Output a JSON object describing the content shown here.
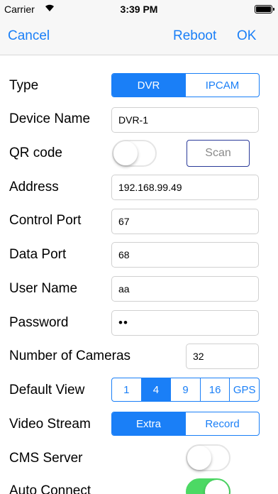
{
  "status_bar": {
    "carrier": "Carrier",
    "time": "3:39 PM"
  },
  "nav": {
    "cancel": "Cancel",
    "reboot": "Reboot",
    "ok": "OK"
  },
  "form": {
    "type": {
      "label": "Type",
      "options": [
        "DVR",
        "IPCAM"
      ],
      "selected": "DVR"
    },
    "device_name": {
      "label": "Device Name",
      "value": "DVR-1"
    },
    "qr_code": {
      "label": "QR code",
      "enabled": false,
      "scan_label": "Scan"
    },
    "address": {
      "label": "Address",
      "value": "192.168.99.49"
    },
    "control_port": {
      "label": "Control Port",
      "value": "67"
    },
    "data_port": {
      "label": "Data Port",
      "value": "68"
    },
    "user_name": {
      "label": "User Name",
      "value": "aa"
    },
    "password": {
      "label": "Password",
      "masked": "••"
    },
    "num_cameras": {
      "label": "Number of Cameras",
      "value": "32"
    },
    "default_view": {
      "label": "Default View",
      "options": [
        "1",
        "4",
        "9",
        "16",
        "GPS"
      ],
      "selected": "4"
    },
    "video_stream": {
      "label": "Video Stream",
      "options": [
        "Extra",
        "Record"
      ],
      "selected": "Extra"
    },
    "cms_server": {
      "label": "CMS Server",
      "enabled": false
    },
    "auto_connect": {
      "label": "Auto Connect",
      "enabled": true
    }
  },
  "colors": {
    "accent": "#1a7ff7",
    "toggle_on": "#4cd964"
  }
}
